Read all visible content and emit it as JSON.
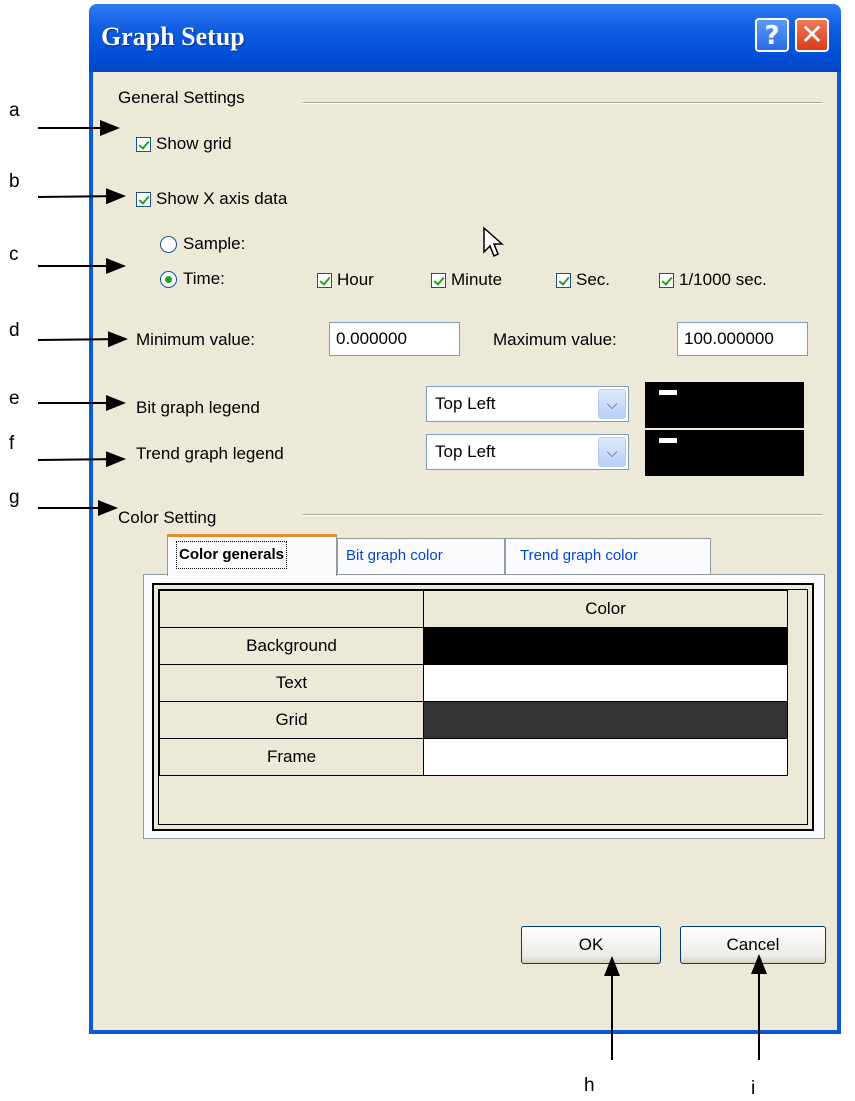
{
  "window": {
    "title": "Graph Setup",
    "help_glyph": "?",
    "close_glyph": "✕"
  },
  "general": {
    "header": "General Settings",
    "show_grid": {
      "label": "Show grid",
      "checked": true
    },
    "show_x_axis": {
      "label": "Show X axis data",
      "checked": true
    },
    "sample": {
      "label": "Sample:",
      "selected": false
    },
    "time": {
      "label": "Time:",
      "selected": true
    },
    "hour": {
      "label": "Hour",
      "checked": true
    },
    "minute": {
      "label": "Minute",
      "checked": true
    },
    "sec": {
      "label": "Sec.",
      "checked": true
    },
    "msec": {
      "label": "1/1000 sec.",
      "checked": true
    },
    "min_label": "Minimum value:",
    "min_value": "0.000000",
    "max_label": "Maximum value:",
    "max_value": "100.000000",
    "bit_legend_label": "Bit graph legend",
    "bit_legend_value": "Top Left",
    "trend_legend_label": "Trend graph legend",
    "trend_legend_value": "Top Left"
  },
  "color": {
    "header": "Color Setting",
    "tabs": [
      {
        "label": "Color generals",
        "active": true
      },
      {
        "label": "Bit graph color",
        "active": false
      },
      {
        "label": "Trend graph color",
        "active": false
      }
    ],
    "table": {
      "column_header": "Color",
      "rows": [
        {
          "name": "Background",
          "color": "#000000"
        },
        {
          "name": "Text",
          "color": "#ffffff"
        },
        {
          "name": "Grid",
          "color": "#333333"
        },
        {
          "name": "Frame",
          "color": "#ffffff"
        }
      ]
    }
  },
  "buttons": {
    "ok": "OK",
    "cancel": "Cancel"
  },
  "annotations": [
    "a",
    "b",
    "c",
    "d",
    "e",
    "f",
    "g",
    "h",
    "i"
  ],
  "colors": {
    "title_bar": "#0a5ad6",
    "dialog_bg": "#ece9d8",
    "check_green": "#21a121",
    "tab_accent": "#e68b2c",
    "tab_text": "#0046d5"
  }
}
